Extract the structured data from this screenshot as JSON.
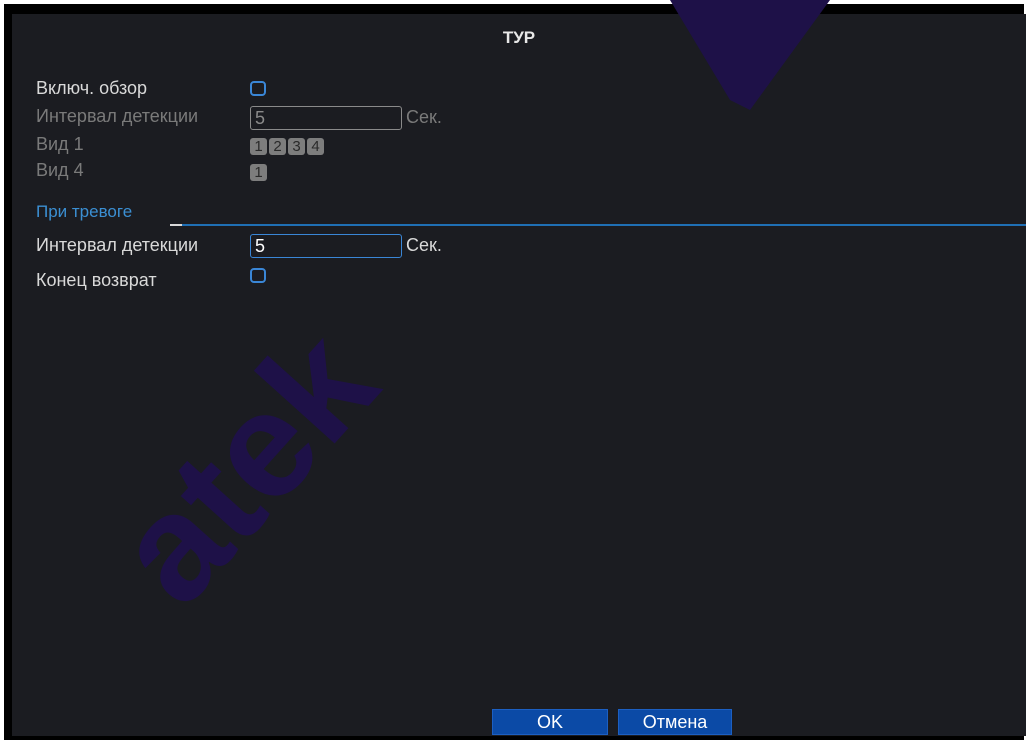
{
  "dialog": {
    "title": "ТУР"
  },
  "tour": {
    "enable_label": "Включ. обзор",
    "interval_label": "Интервал детекции",
    "interval_value": "5",
    "interval_unit": "Сек.",
    "view1_label": "Вид 1",
    "view1_channels": [
      "1",
      "2",
      "3",
      "4"
    ],
    "view4_label": "Вид 4",
    "view4_channels": [
      "1"
    ]
  },
  "alarm": {
    "section_label": "При тревоге",
    "interval_label": "Интервал детекции",
    "interval_value": "5",
    "interval_unit": "Сек.",
    "end_return_label": "Конец возврат"
  },
  "buttons": {
    "ok": "OK",
    "cancel": "Отмена"
  },
  "watermark": {
    "text": "atek"
  },
  "colors": {
    "accent": "#3a86d6",
    "button": "#0b4aa6",
    "background": "#1b1c21",
    "watermark": "#1e1148"
  }
}
